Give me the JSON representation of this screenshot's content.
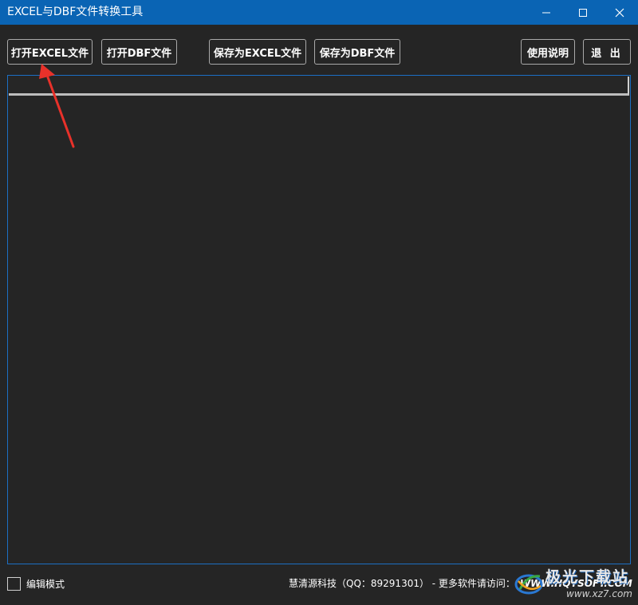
{
  "window": {
    "title": "EXCEL与DBF文件转换工具",
    "controls": {
      "minimize_icon": "minimize-icon",
      "maximize_icon": "maximize-icon",
      "close_icon": "close-icon"
    },
    "title_bar_color": "#0a64b4"
  },
  "toolbar": {
    "open_excel_label": "打开EXCEL文件",
    "open_dbf_label": "打开DBF文件",
    "save_excel_label": "保存为EXCEL文件",
    "save_dbf_label": "保存为DBF文件",
    "help_label": "使用说明",
    "exit_label": "退 出"
  },
  "grid": {
    "border_color": "#1c6fc4",
    "rows": []
  },
  "annotation": {
    "arrow_color": "#e8312a",
    "arrow_target": "open-excel-button"
  },
  "footer": {
    "edit_mode_label": "编辑模式",
    "edit_mode_checked": false,
    "company_text": "慧清源科技（QQ：89291301） - 更多软件请访问：",
    "link_text": "WWW.HQYSOFT.COM"
  },
  "watermark": {
    "text": "极光下载站",
    "domain": "www.xz7.com"
  }
}
